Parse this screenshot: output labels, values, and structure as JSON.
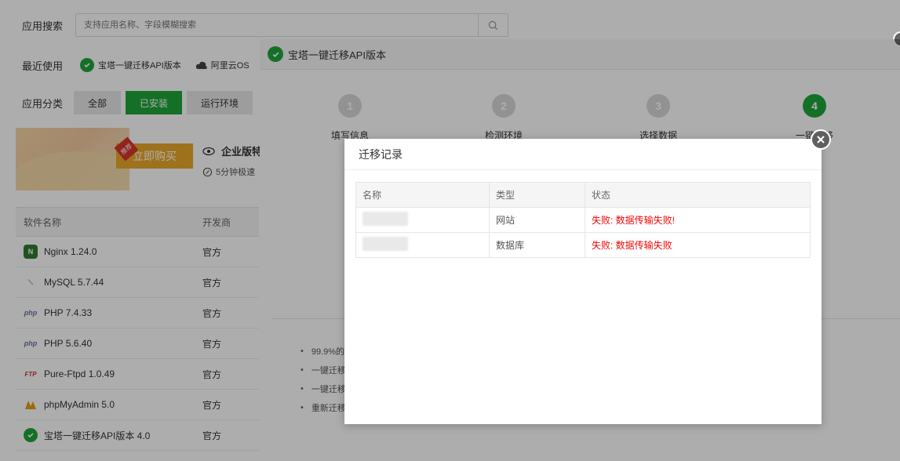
{
  "search": {
    "label": "应用搜索",
    "placeholder": "支持应用名称、字段模糊搜索"
  },
  "recent": {
    "label": "最近使用",
    "items": [
      "宝塔一键迁移API版本",
      "阿里云OS"
    ]
  },
  "category": {
    "label": "应用分类",
    "tabs": [
      {
        "label": "全部",
        "active": false
      },
      {
        "label": "已安装",
        "active": true
      },
      {
        "label": "运行环境",
        "active": false
      }
    ]
  },
  "promo": {
    "buy_label": "立即购买",
    "badge": "推荐",
    "title": "企业版特",
    "subtitle": "5分钟极速"
  },
  "software_table": {
    "headers": [
      "软件名称",
      "开发商"
    ],
    "rows": [
      {
        "name": "Nginx 1.24.0",
        "vendor": "官方",
        "icon": "nginx-icon"
      },
      {
        "name": "MySQL 5.7.44",
        "vendor": "官方",
        "icon": "mysql-icon"
      },
      {
        "name": "PHP 7.4.33",
        "vendor": "官方",
        "icon": "php-icon"
      },
      {
        "name": "PHP 5.6.40",
        "vendor": "官方",
        "icon": "php-icon"
      },
      {
        "name": "Pure-Ftpd 1.0.49",
        "vendor": "官方",
        "icon": "ftp-icon"
      },
      {
        "name": "phpMyAdmin 5.0",
        "vendor": "官方",
        "icon": "phpmyadmin-icon"
      },
      {
        "name": "宝塔一键迁移API版本 4.0",
        "vendor": "官方",
        "icon": "check-icon"
      }
    ]
  },
  "wizard": {
    "title": "宝塔一键迁移API版本",
    "steps": [
      {
        "num": "1",
        "label": "填写信息",
        "done": false
      },
      {
        "num": "2",
        "label": "检测环境",
        "done": false
      },
      {
        "num": "3",
        "label": "选择数据",
        "done": false
      },
      {
        "num": "4",
        "label": "一键迁移",
        "done": true
      }
    ],
    "notes": [
      "99.9%的",
      "一键迁移",
      "一键迁移",
      "重新迁移"
    ]
  },
  "record_modal": {
    "title": "迁移记录",
    "headers": [
      "名称",
      "类型",
      "状态"
    ],
    "rows": [
      {
        "type": "网站",
        "status": "失败: 数据传输失败!"
      },
      {
        "type": "数据库",
        "status": "失败: 数据传输失败"
      }
    ]
  },
  "colors": {
    "brand_green": "#20a53a",
    "fail_red": "#ef0808",
    "promo_gold": "#e9a92a"
  }
}
